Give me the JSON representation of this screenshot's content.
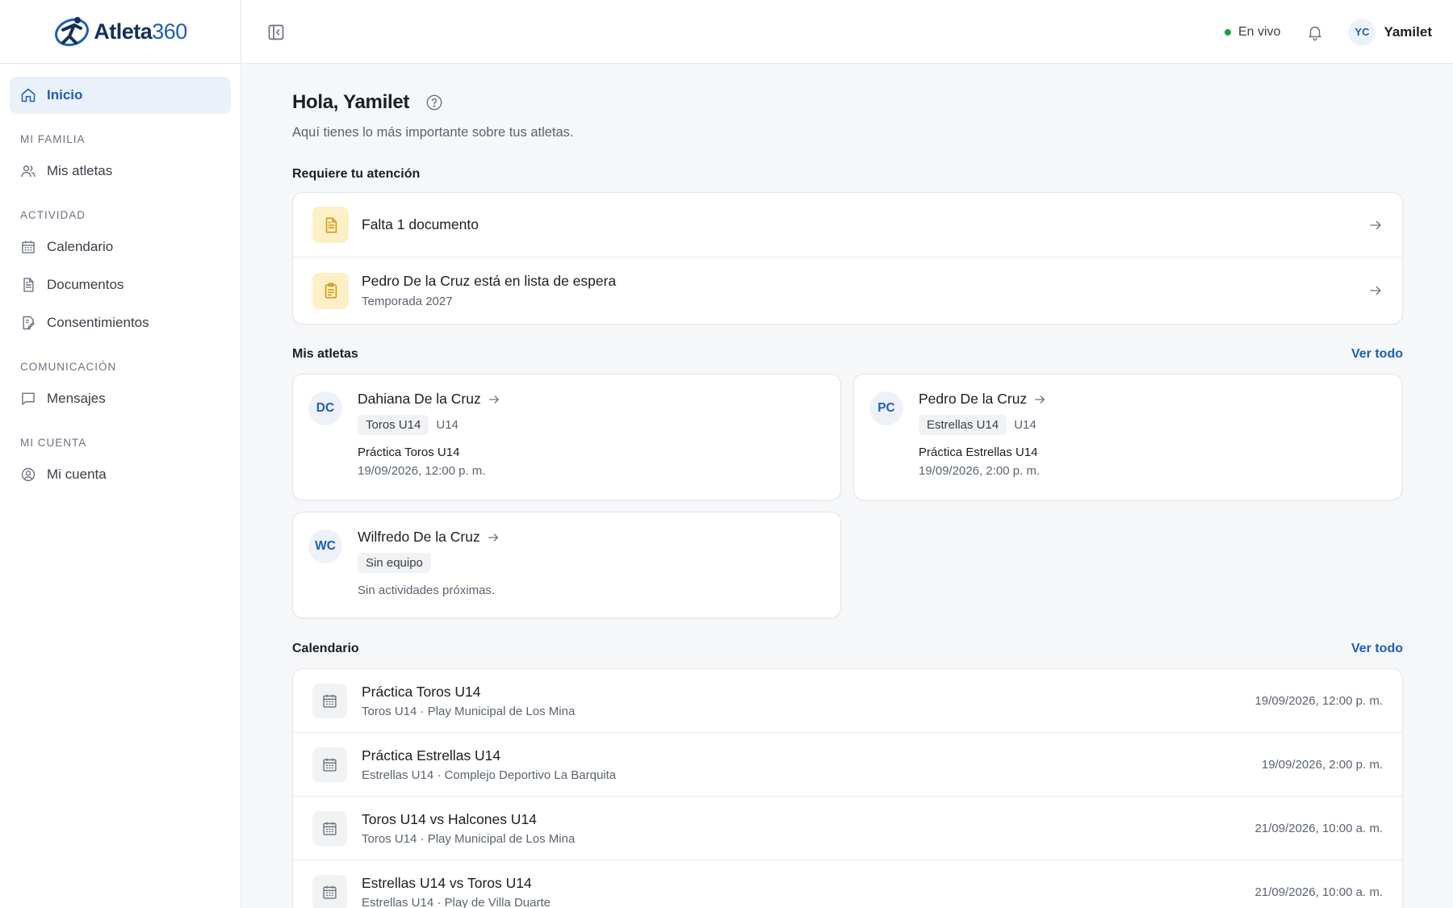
{
  "app": {
    "logo_text": "Atleta",
    "logo_num": "360"
  },
  "sidebar": {
    "items": [
      {
        "label": "Inicio",
        "icon": "home-icon",
        "active": true
      }
    ],
    "sections": [
      {
        "title": "MI FAMILIA",
        "items": [
          {
            "label": "Mis atletas",
            "icon": "users-icon"
          }
        ]
      },
      {
        "title": "ACTIVIDAD",
        "items": [
          {
            "label": "Calendario",
            "icon": "calendar-icon"
          },
          {
            "label": "Documentos",
            "icon": "document-icon"
          },
          {
            "label": "Consentimientos",
            "icon": "consent-icon"
          }
        ]
      },
      {
        "title": "COMUNICACIÓN",
        "items": [
          {
            "label": "Mensajes",
            "icon": "message-icon"
          }
        ]
      },
      {
        "title": "MI CUENTA",
        "items": [
          {
            "label": "Mi cuenta",
            "icon": "account-icon"
          }
        ]
      }
    ]
  },
  "topbar": {
    "live_label": "En vivo",
    "live_color": "#16a34a",
    "user_initials": "YC",
    "user_name": "Yamilet"
  },
  "main": {
    "greeting": "Hola, Yamilet",
    "subtitle": "Aquí tienes lo más importante sobre tus atletas.",
    "attention": {
      "title": "Requiere tu atención",
      "items": [
        {
          "title": "Falta 1 documento",
          "sub": "",
          "icon": "document-icon"
        },
        {
          "title": "Pedro De la Cruz está en lista de espera",
          "sub": "Temporada 2027",
          "icon": "clipboard-icon"
        }
      ]
    },
    "athletes": {
      "title": "Mis atletas",
      "see_all": "Ver todo",
      "items": [
        {
          "initials": "DC",
          "name": "Dahiana De la Cruz",
          "team": "Toros U14",
          "category": "U14",
          "event": "Práctica Toros U14",
          "date": "19/09/2026, 12:00 p. m."
        },
        {
          "initials": "PC",
          "name": "Pedro De la Cruz",
          "team": "Estrellas U14",
          "category": "U14",
          "event": "Práctica Estrellas U14",
          "date": "19/09/2026, 2:00 p. m."
        },
        {
          "initials": "WC",
          "name": "Wilfredo De la Cruz",
          "team": "Sin equipo",
          "category": "",
          "event": "",
          "date": "",
          "none_text": "Sin actividades próximas."
        }
      ]
    },
    "calendar": {
      "title": "Calendario",
      "see_all": "Ver todo",
      "items": [
        {
          "title": "Práctica Toros U14",
          "sub": "Toros U14 · Play Municipal de Los Mina",
          "date": "19/09/2026, 12:00 p. m."
        },
        {
          "title": "Práctica Estrellas U14",
          "sub": "Estrellas U14 · Complejo Deportivo La Barquita",
          "date": "19/09/2026, 2:00 p. m."
        },
        {
          "title": "Toros U14 vs Halcones U14",
          "sub": "Toros U14 · Play Municipal de Los Mina",
          "date": "21/09/2026, 10:00 a. m."
        },
        {
          "title": "Estrellas U14 vs Toros U14",
          "sub": "Estrellas U14 · Play de Villa Duarte",
          "date": "21/09/2026, 10:00 a. m."
        }
      ]
    }
  }
}
